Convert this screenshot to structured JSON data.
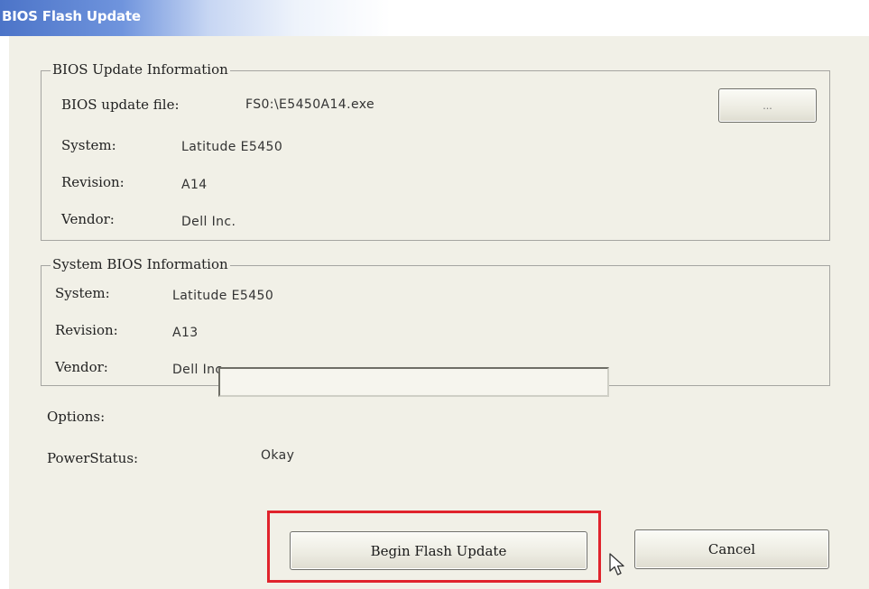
{
  "window": {
    "title": "BIOS Flash Update"
  },
  "bios_update_info": {
    "group_title": "BIOS Update Information",
    "file_label": "BIOS update file:",
    "file_value": "FS0:\\E5450A14.exe",
    "browse_label": "...",
    "system_label": "System:",
    "system_value": "Latitude E5450",
    "revision_label": "Revision:",
    "revision_value": "A14",
    "vendor_label": "Vendor:",
    "vendor_value": "Dell Inc."
  },
  "system_bios_info": {
    "group_title": "System BIOS Information",
    "system_label": "System:",
    "system_value": "Latitude E5450",
    "revision_label": "Revision:",
    "revision_value": "A13",
    "vendor_label": "Vendor:",
    "vendor_value": "Dell Inc."
  },
  "options": {
    "label": "Options:",
    "value": ""
  },
  "power_status": {
    "label": "PowerStatus:",
    "value": "Okay"
  },
  "buttons": {
    "begin_flash_update": "Begin Flash Update",
    "cancel": "Cancel"
  },
  "colors": {
    "titlebar_blue": "#4c74c8",
    "dialog_background": "#f1f0e7",
    "highlight_red": "#e0232c"
  },
  "icons": {
    "cursor": "mouse-pointer-icon"
  }
}
